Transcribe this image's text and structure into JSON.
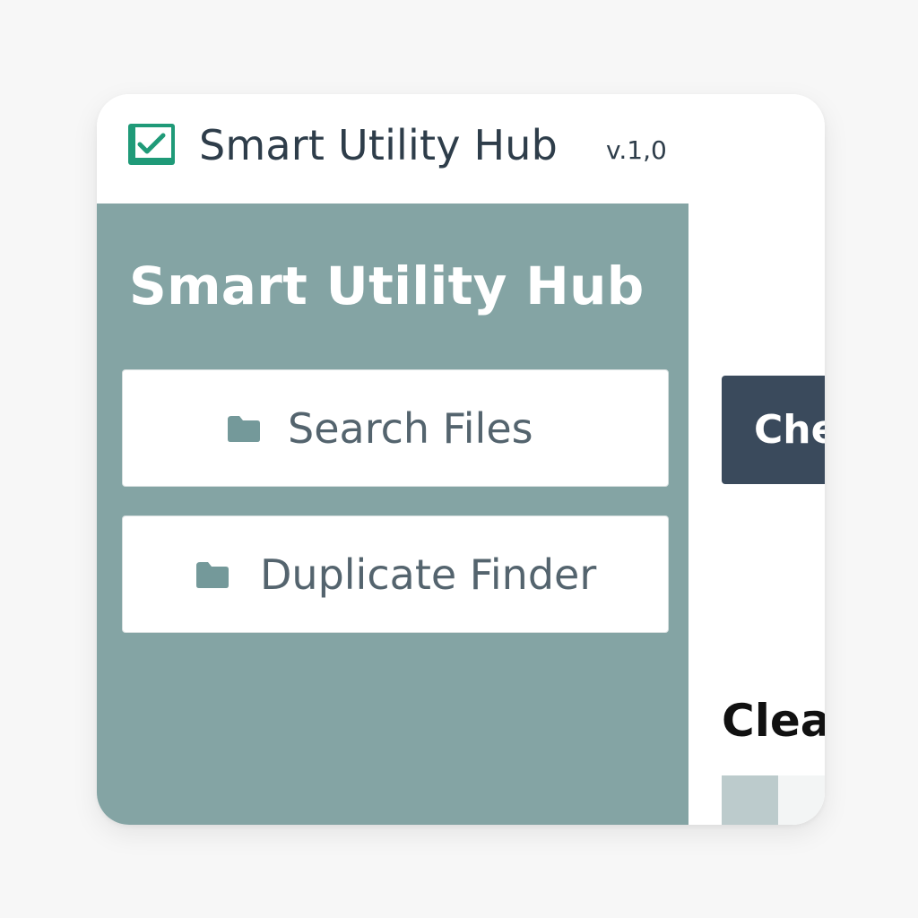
{
  "window": {
    "title": "Smart Utility Hub",
    "version": "v.1,0",
    "icon": "checklist-app-icon"
  },
  "sidebar": {
    "heading": "Smart Utility Hub",
    "items": [
      {
        "label": "Search Files",
        "icon": "folder-icon"
      },
      {
        "label": "Duplicate Finder",
        "icon": "folder-icon"
      }
    ]
  },
  "main": {
    "action_button_label": "Che",
    "section_heading": "Clea"
  },
  "colors": {
    "sidebar_bg": "#84a4a4",
    "action_button_bg": "#3a4a5c",
    "icon_green": "#1f9a78",
    "text_dark": "#2e3d4a"
  }
}
